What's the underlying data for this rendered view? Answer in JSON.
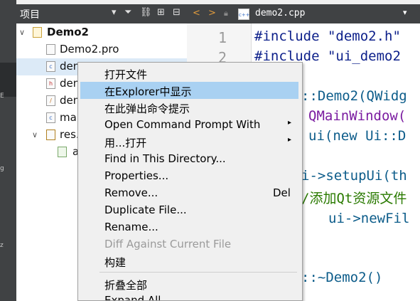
{
  "project_panel": {
    "title": "项目",
    "controls": [
      "▾",
      "⏷",
      "⛓",
      "⊞",
      "⊟"
    ]
  },
  "tree": [
    {
      "label": "Demo2",
      "icon": "qt-project-icon",
      "arrow": "∨",
      "bold": true
    },
    {
      "label": "Demo2.pro",
      "icon": "pro-file-icon"
    },
    {
      "label": "dem",
      "icon": "cpp-file-icon",
      "selected": true
    },
    {
      "label": "dem",
      "icon": "header-file-icon"
    },
    {
      "label": "dem",
      "icon": "ui-file-icon"
    },
    {
      "label": "mai",
      "icon": "cpp-file-icon"
    },
    {
      "label": "res.",
      "icon": "resource-file-icon",
      "arrow": "∨"
    },
    {
      "label": "a",
      "icon": "resource-item-icon"
    }
  ],
  "editor": {
    "tab_filename": "demo2.cpp",
    "nav_back": "<",
    "nav_forward": ">",
    "line_numbers": [
      "1",
      "2"
    ],
    "code_line1": "#include \"demo2.h\"",
    "code_line2": "#include \"ui_demo2",
    "code_line3": "::Demo2(QWidg",
    "code_line4": "QMainWindow(",
    "code_line5": "ui(new Ui::D",
    "code_line6": "i->setupUi(th",
    "code_line7": "/添加Qt资源文件",
    "code_line8": "ui->newFil",
    "code_line9": "::~Demo2()"
  },
  "context_menu": {
    "items": [
      {
        "label": "打开文件"
      },
      {
        "label": "在Explorer中显示",
        "selected": true
      },
      {
        "label": "在此弹出命令提示"
      },
      {
        "label": "Open Command Prompt With",
        "submenu": true
      },
      {
        "label": "用...打开",
        "submenu": true
      },
      {
        "label": "Find in This Directory..."
      },
      {
        "label": "Properties..."
      },
      {
        "label": "Remove...",
        "shortcut": "Del"
      },
      {
        "label": "Duplicate File..."
      },
      {
        "label": "Rename..."
      },
      {
        "label": "Diff Against Current File",
        "disabled": true
      },
      {
        "label": "构建"
      },
      {
        "label": "折叠全部"
      },
      {
        "label": "Expand All"
      }
    ],
    "submenu_glyph": "▸"
  },
  "left_strip_glyphs": [
    "E",
    "s",
    "g",
    "z"
  ]
}
